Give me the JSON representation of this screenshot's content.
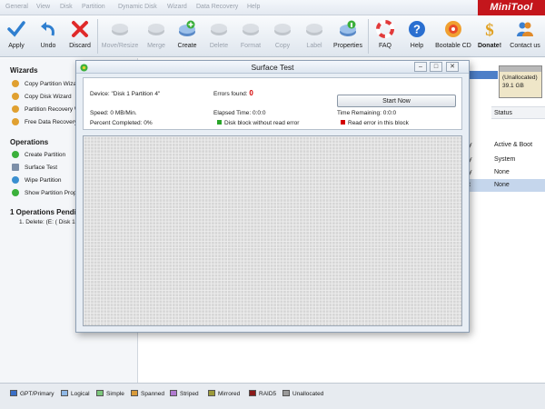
{
  "menu": [
    "General",
    "View",
    "Disk",
    "Partition",
    "Dynamic Disk",
    "Wizard",
    "Data Recovery",
    "Help"
  ],
  "brand": "MiniTool",
  "toolbar": {
    "apply": "Apply",
    "undo": "Undo",
    "discard": "Discard",
    "move_resize": "Move/Resize",
    "merge": "Merge",
    "create": "Create",
    "delete": "Delete",
    "format": "Format",
    "copy": "Copy",
    "label": "Label",
    "properties": "Properties",
    "faq": "FAQ",
    "help": "Help",
    "bootable_cd": "Bootable CD",
    "donate": "Donate!",
    "contact": "Contact us"
  },
  "sidebar": {
    "wizards_title": "Wizards",
    "wizards": [
      "Copy Partition Wizard",
      "Copy Disk Wizard",
      "Partition Recovery Wizard",
      "Free Data Recovery"
    ],
    "operations_title": "Operations",
    "operations": [
      "Create Partition",
      "Surface Test",
      "Wipe Partition",
      "Show Partition Properties"
    ],
    "pending_title": "1 Operations Pending",
    "pending": [
      "1. Delete: (E: ( Disk 1"
    ]
  },
  "disk_map": {
    "label": "(Unallocated)",
    "size": "39.1 GB"
  },
  "table": {
    "status_header": "Status",
    "rows": [
      {
        "prefix": "y",
        "status": "Active & Boot"
      },
      {
        "prefix": "y",
        "status": "System"
      },
      {
        "prefix": "y",
        "status": "None"
      },
      {
        "prefix": "t",
        "status": "None"
      }
    ]
  },
  "dialog": {
    "title": "Surface Test",
    "device_label": "Device:",
    "device_value": "\"Disk 1 Partition 4\"",
    "errors_label": "Errors found:",
    "errors_value": "0",
    "speed_label": "Speed:",
    "speed_value": "0 MB/Min.",
    "elapsed_label": "Elapsed Time:",
    "elapsed_value": "0:0:0",
    "remaining_label": "Time Remaining:",
    "remaining_value": "0:0:0",
    "percent_label": "Percent Completed:",
    "percent_value": "0%",
    "legend_ok": "Disk block without read error",
    "legend_err": "Read error in this block",
    "start_button": "Start Now"
  },
  "legend": [
    "GPT/Primary",
    "Logical",
    "Simple",
    "Spanned",
    "Striped",
    "Mirrored",
    "RAID5",
    "Unallocated"
  ],
  "colors": {
    "gpt_primary": "#3a6fc7",
    "logical": "#8fb8e6",
    "simple": "#7cc77c",
    "spanned": "#d89a3a",
    "striped": "#b07ad0",
    "mirrored": "#9c9a3a",
    "raid5": "#8a1a1a",
    "unallocated": "#9a9a9a",
    "ok_block": "#2aa52a",
    "err_block": "#d40000",
    "brand_red": "#c4161c"
  }
}
